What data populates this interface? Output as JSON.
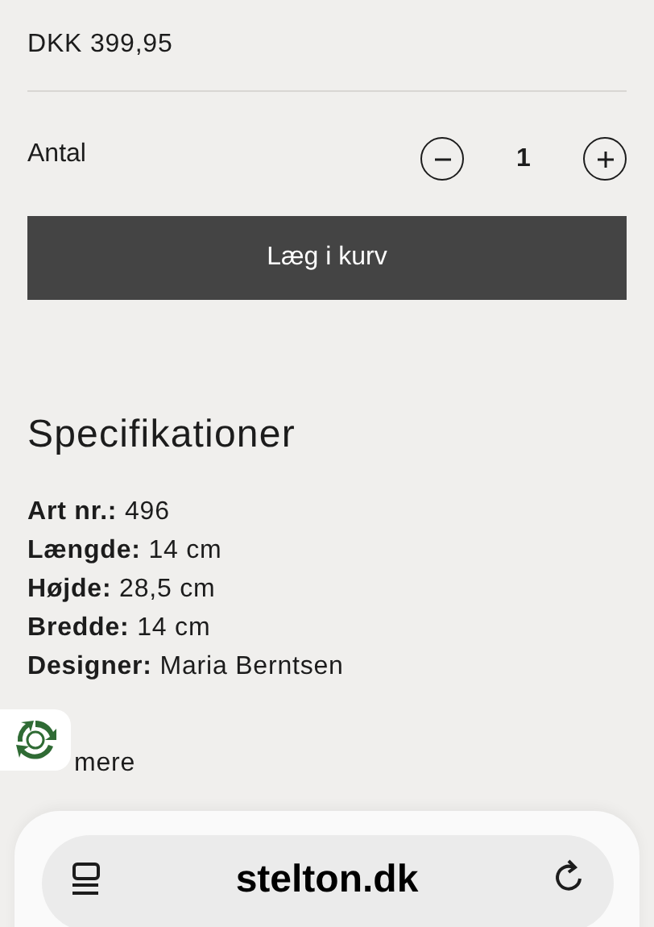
{
  "price": "DKK 399,95",
  "quantity": {
    "label": "Antal",
    "value": "1"
  },
  "add_to_cart": "Læg i kurv",
  "specifications": {
    "title": "Specifikationer",
    "items": [
      {
        "text": "**Art nr.:** 496"
      },
      {
        "text": "**Længde:** 14 cm"
      },
      {
        "text": "**Højde:** 28,5 cm"
      },
      {
        "text": "**Bredde:** 14 cm"
      },
      {
        "text": "**Designer:** Maria Berntsen"
      }
    ]
  },
  "show_more": "mere",
  "browser_bar": {
    "url": "stelton.dk"
  }
}
